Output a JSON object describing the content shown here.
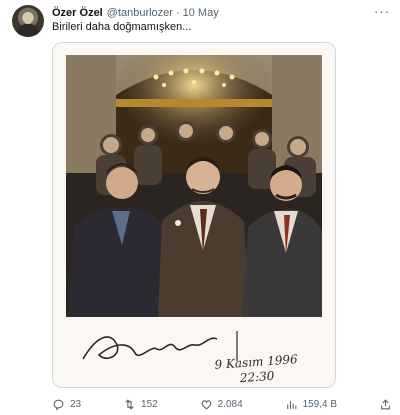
{
  "tweet": {
    "author_name": "Özer Özel",
    "handle": "@tanburlozer",
    "separator": "·",
    "date": "10 May",
    "text": "Birileri daha doğmamışken...",
    "more_label": "···"
  },
  "media": {
    "signature": "Özel",
    "handwritten_date": "9 Kasım 1996",
    "handwritten_time": "22:30"
  },
  "actions": {
    "replies": "23",
    "retweets": "152",
    "likes": "2.084",
    "views": "159,4 B"
  },
  "colors": {
    "text_primary": "#0f1419",
    "text_secondary": "#536471",
    "border": "#cfd9de"
  }
}
